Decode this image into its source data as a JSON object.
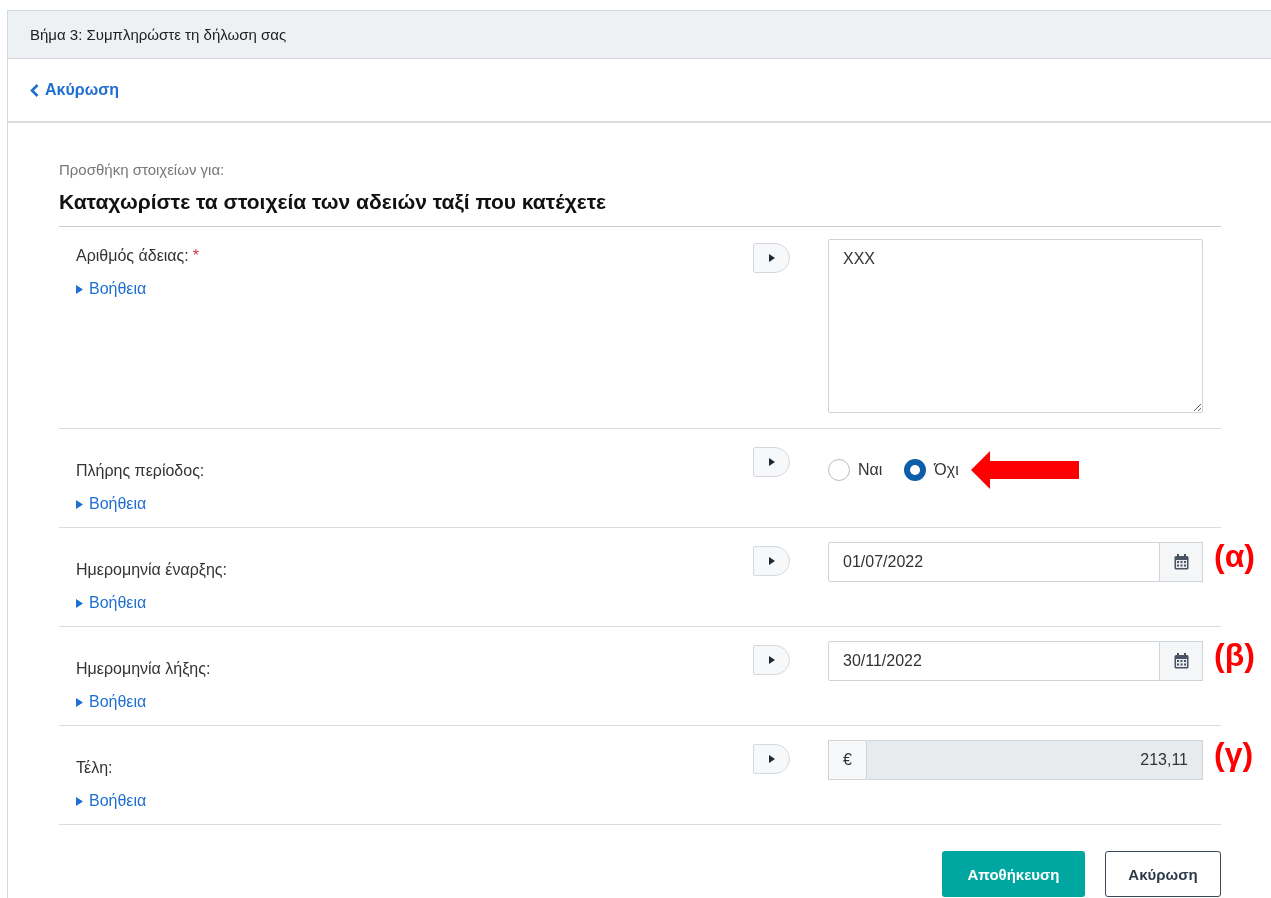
{
  "header": {
    "title": "Βήμα 3: Συμπληρώστε τη δήλωση σας"
  },
  "back_link": {
    "label": "Ακύρωση"
  },
  "form": {
    "subtitle": "Προσθήκη στοιχείων για:",
    "heading": "Καταχωρίστε τα στοιχεία των αδειών ταξί που κατέχετε"
  },
  "fields": [
    {
      "kind": "textarea",
      "label": "Αριθμός άδειας:",
      "required_mark": "*",
      "help": "Βοήθεια",
      "value": "XXX"
    },
    {
      "kind": "radio",
      "label": "Πλήρης περίοδος:",
      "help": "Βοήθεια",
      "options": [
        {
          "label": "Ναι",
          "selected": false,
          "marked": false
        },
        {
          "label": "Όχι",
          "selected": true,
          "marked": true
        }
      ]
    },
    {
      "kind": "date",
      "label": "Ημερομηνία έναρξης:",
      "help": "Βοήθεια",
      "value": "01/07/2022",
      "annotation": "(α)"
    },
    {
      "kind": "date",
      "label": "Ημερομηνία λήξης:",
      "help": "Βοήθεια",
      "value": "30/11/2022",
      "annotation": "(β)"
    },
    {
      "kind": "currency",
      "label": "Τέλη:",
      "help": "Βοήθεια",
      "prefix": "€",
      "value": "213,11",
      "disabled": true,
      "annotation": "(γ)"
    }
  ],
  "buttons": [
    {
      "label": "Αποθήκευση",
      "kind": "primary"
    },
    {
      "label": "Ακύρωση",
      "kind": "secondary"
    }
  ]
}
